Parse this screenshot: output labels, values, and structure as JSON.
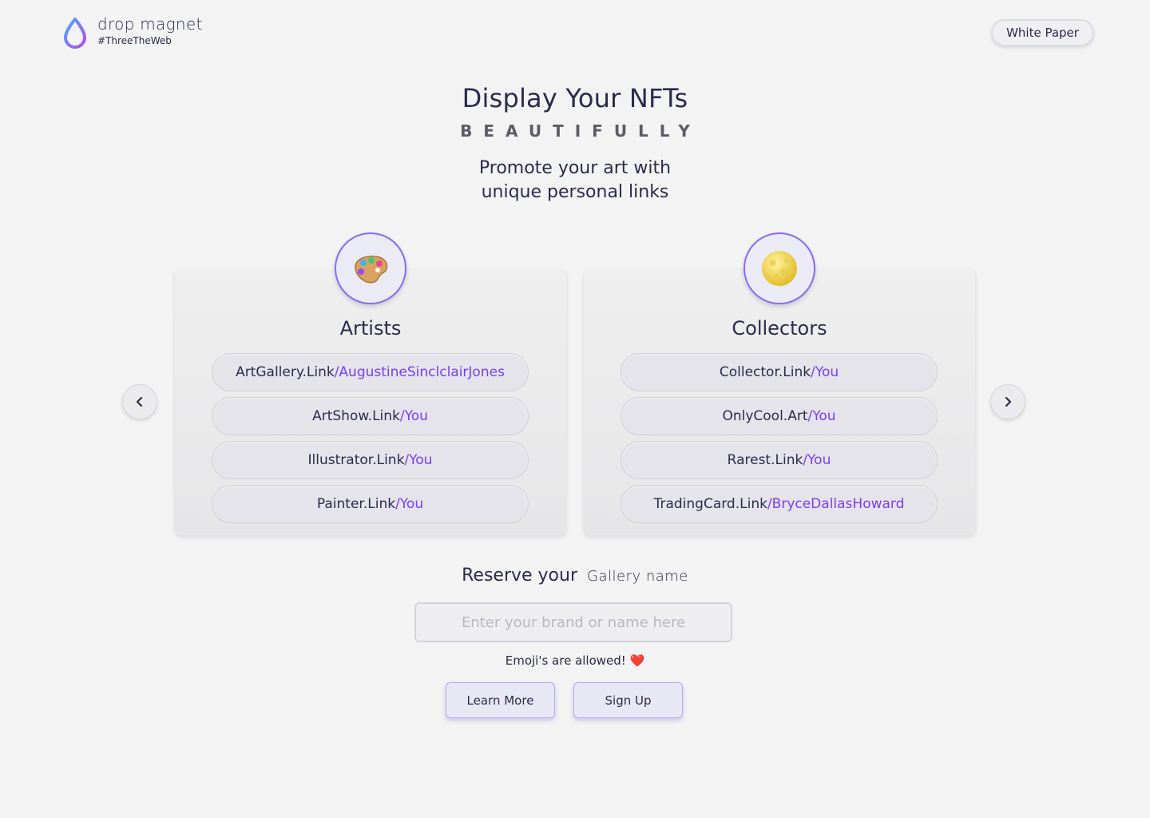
{
  "header": {
    "brand": "drop magnet",
    "tagline": "#ThreeTheWeb",
    "white_paper_label": "White Paper"
  },
  "hero": {
    "title": "Display Your NFTs",
    "subtitle": "BEAUTIFULLY",
    "line1": "Promote your art with",
    "line2": "unique personal links"
  },
  "cards": [
    {
      "title": "Artists",
      "icon": "palette-icon",
      "links": [
        {
          "domain": "ArtGallery.Link",
          "suffix": "/AugustineSinclclairJones"
        },
        {
          "domain": "ArtShow.Link",
          "suffix": "/You"
        },
        {
          "domain": "Illustrator.Link",
          "suffix": "/You"
        },
        {
          "domain": "Painter.Link",
          "suffix": "/You"
        }
      ]
    },
    {
      "title": "Collectors",
      "icon": "moon-icon",
      "links": [
        {
          "domain": "Collector.Link",
          "suffix": "/You"
        },
        {
          "domain": "OnlyCool.Art",
          "suffix": "/You"
        },
        {
          "domain": "Rarest.Link",
          "suffix": "/You"
        },
        {
          "domain": "TradingCard.Link",
          "suffix": "/BryceDallasHoward"
        }
      ]
    }
  ],
  "reserve": {
    "label": "Reserve your",
    "script": "Gallery name",
    "placeholder": "Enter your brand or name here",
    "note": "Emoji's are allowed! ❤️"
  },
  "buttons": {
    "learn_more": "Learn More",
    "sign_up": "Sign Up"
  },
  "colors": {
    "accent": "#7a3ff0",
    "text": "#2a2c4a",
    "background": "#f3f3f3"
  }
}
